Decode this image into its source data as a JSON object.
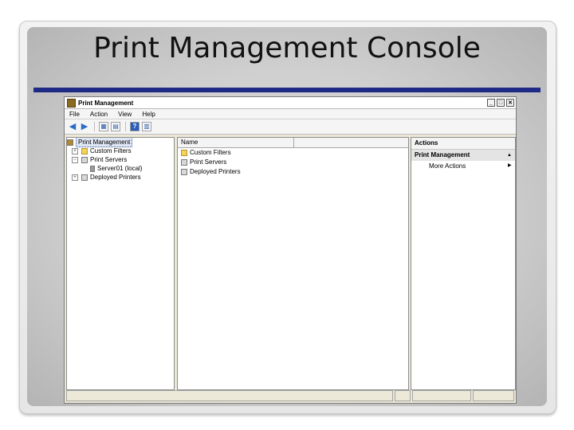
{
  "slide": {
    "title": "Print Management Console",
    "rule_color": "#1e2a86"
  },
  "window": {
    "title": "Print Management",
    "title_icon": "print-management-icon",
    "controls": [
      "minimize-icon",
      "maximize-icon",
      "close-icon"
    ]
  },
  "menu": [
    "File",
    "Action",
    "View",
    "Help"
  ],
  "toolbar": {
    "buttons": [
      "back-arrow-icon",
      "forward-arrow-icon",
      "console-tree-icon",
      "export-list-icon",
      "help-icon",
      "show-hide-action-pane-icon"
    ]
  },
  "tree": {
    "root": "Print Management",
    "items": [
      {
        "label": "Custom Filters",
        "icon": "filter-folder-icon",
        "expander": "+"
      },
      {
        "label": "Print Servers",
        "icon": "printer-folder-icon",
        "expander": "−"
      },
      {
        "label": "Server01 (local)",
        "icon": "server-icon",
        "expander": ""
      },
      {
        "label": "Deployed Printers",
        "icon": "deployed-printers-icon",
        "expander": "+"
      }
    ]
  },
  "list": {
    "column_name": "Name",
    "items": [
      {
        "label": "Custom Filters",
        "icon": "filter-folder-icon"
      },
      {
        "label": "Print Servers",
        "icon": "printer-folder-icon"
      },
      {
        "label": "Deployed Printers",
        "icon": "deployed-printers-icon"
      }
    ]
  },
  "actions": {
    "header": "Actions",
    "section": "Print Management",
    "items": [
      "More Actions"
    ]
  },
  "colors": {
    "selection_bg": "#dfe7f4",
    "window_bg": "#ece9d8"
  }
}
